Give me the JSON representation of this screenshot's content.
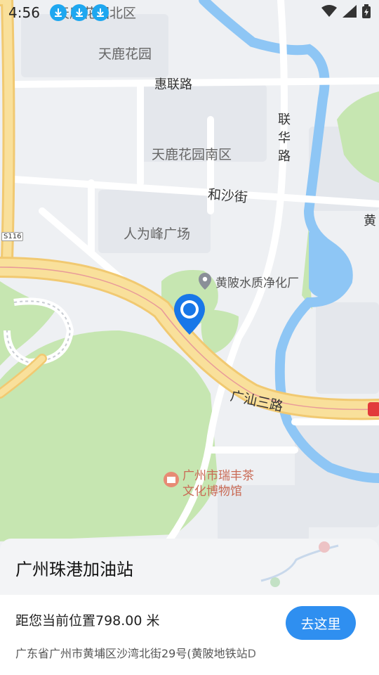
{
  "status_bar": {
    "time": "4:56",
    "download_icons": [
      "download-icon",
      "download-icon",
      "download-icon"
    ],
    "right_icons": [
      "wifi-icon",
      "signal-icon",
      "battery-charging-icon"
    ]
  },
  "map": {
    "areas": {
      "area1": "天鹿花园北区",
      "area2": "天鹿花园",
      "area3": "天鹿花园南区",
      "area4": "人为峰广场"
    },
    "roads": {
      "road1": "惠联路",
      "road2": "联华路",
      "road3": "和沙街",
      "road4": "广汕三路",
      "road5": "黄",
      "road6": "S116"
    },
    "pois": {
      "poi1": "黄陂水质净化厂",
      "poi2_line1": "广州市瑞丰茶",
      "poi2_line2": "文化博物馆"
    },
    "marker": "location-pin-icon"
  },
  "sheet": {
    "place_name": "广州珠港加油站",
    "distance": "距您当前位置798.00 米",
    "address": "广东省广州市黄埔区沙湾北街29号(黄陂地铁站D",
    "go_label": "去这里"
  },
  "colors": {
    "accent": "#2f8ff0",
    "water": "#8ec6f5",
    "green": "#c6e6b1",
    "highway": "#f6d98a"
  }
}
